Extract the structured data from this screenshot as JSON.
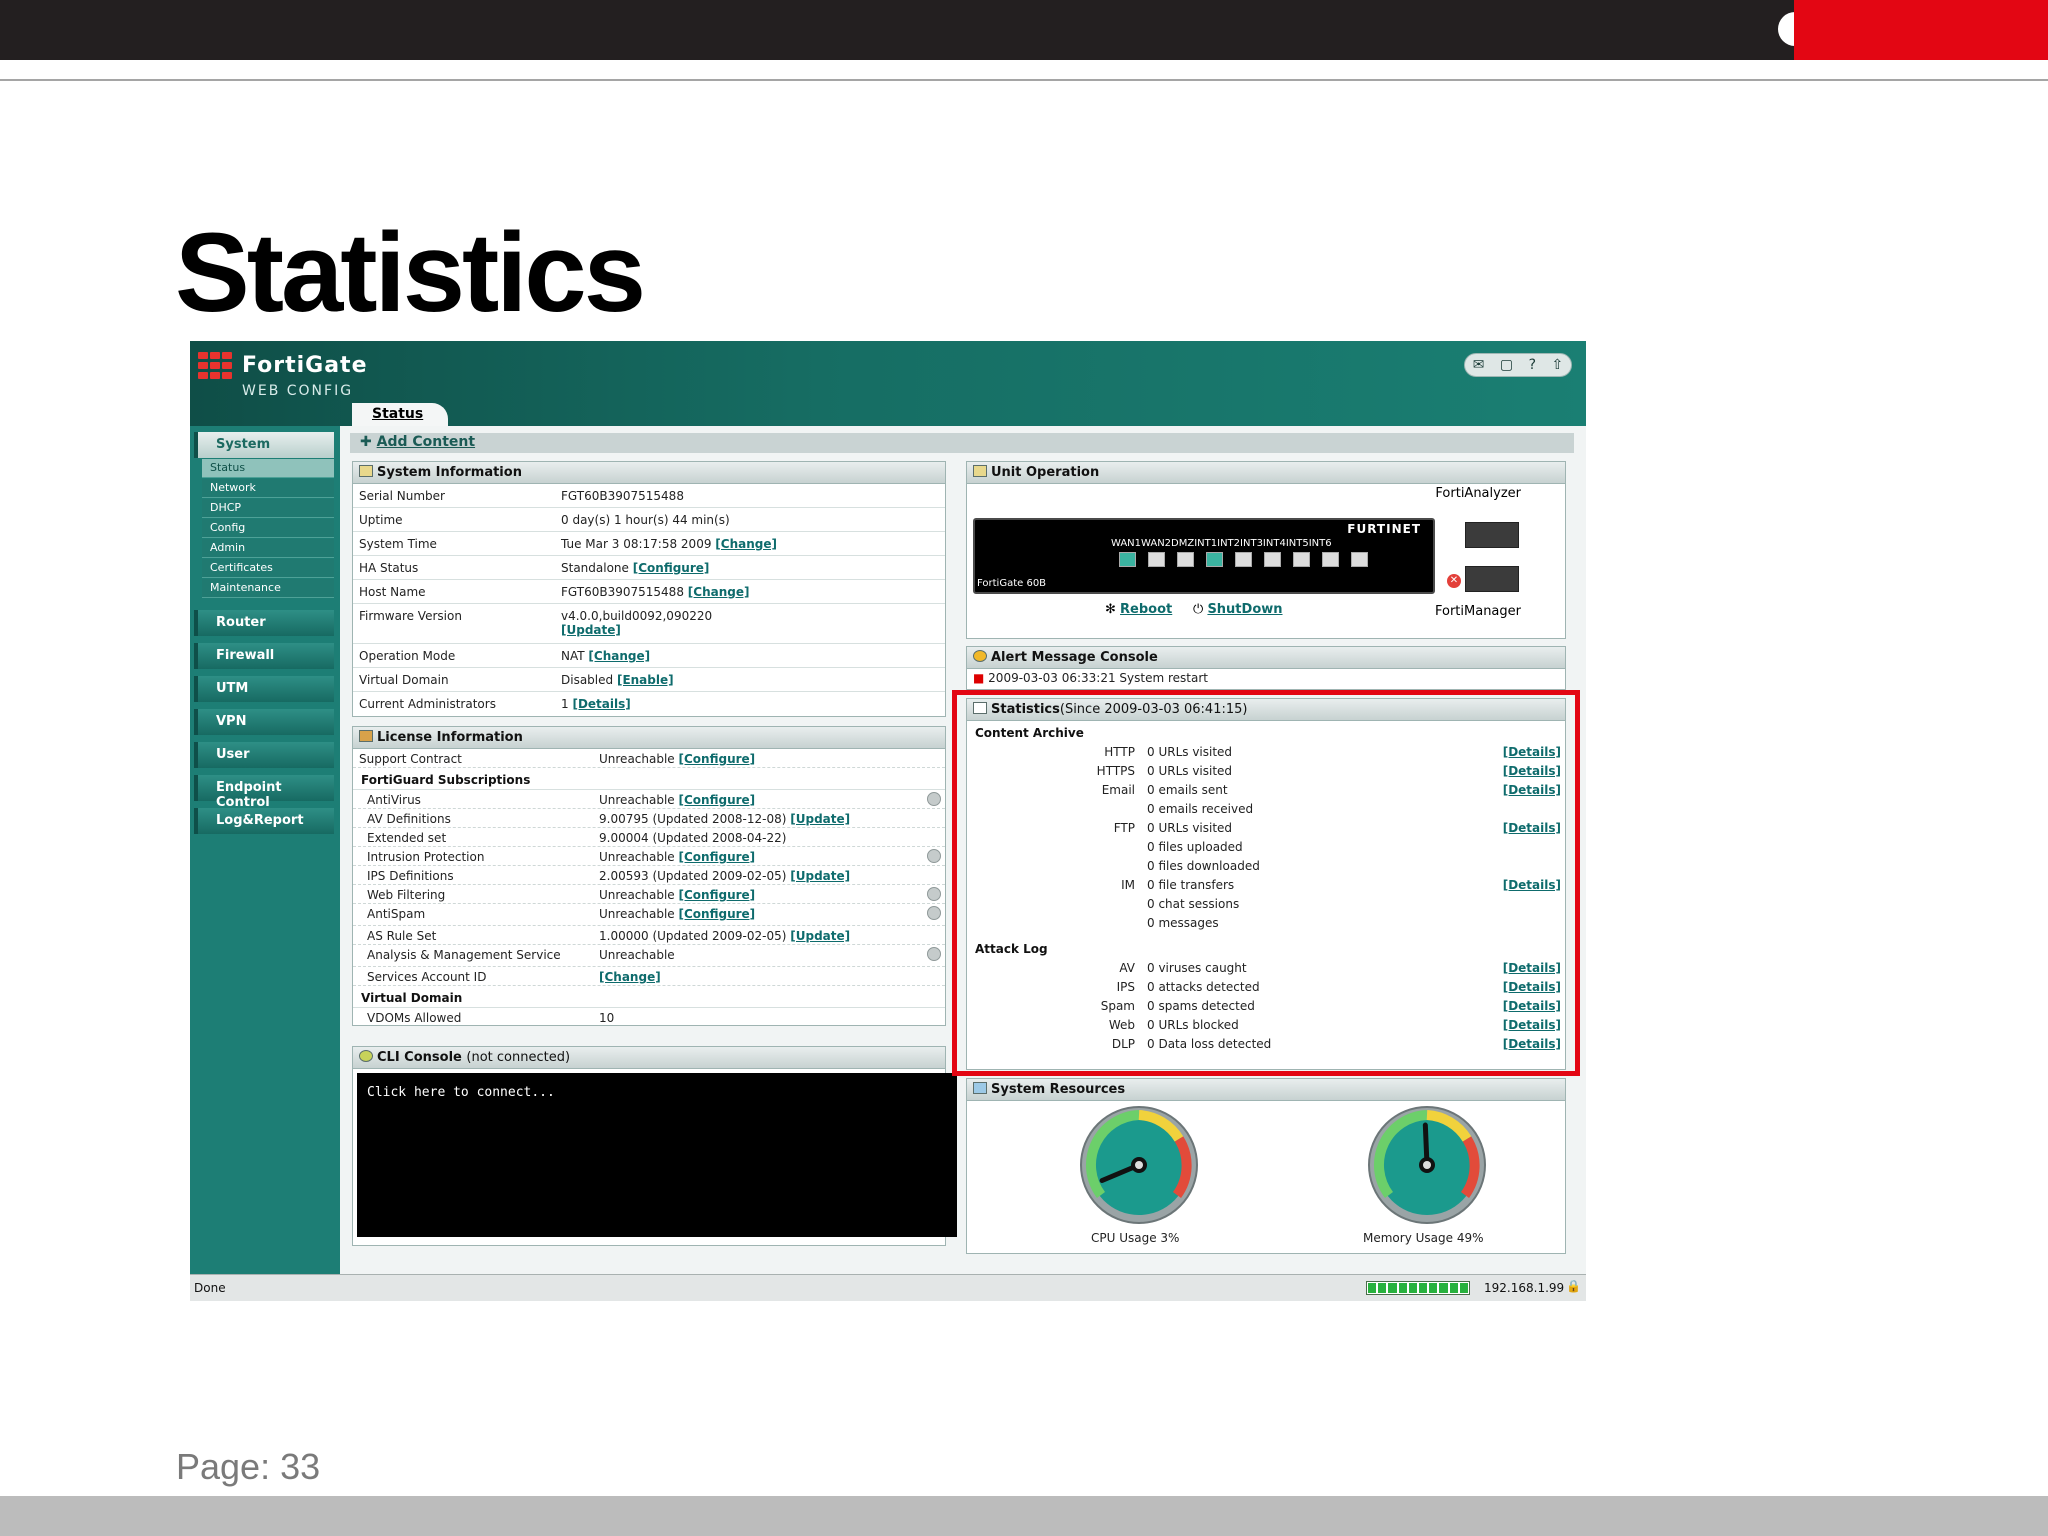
{
  "slide": {
    "title": "Statistics",
    "page": "Page: 33"
  },
  "header": {
    "brand": "FortiGate",
    "sub": "WEB CONFIG",
    "tools": [
      "speech-icon",
      "save-icon",
      "help-icon",
      "logout-icon"
    ]
  },
  "tab": {
    "label": "Status"
  },
  "sidebar": {
    "system_label": "System",
    "system_items": [
      "Status",
      "Network",
      "DHCP",
      "Config",
      "Admin",
      "Certificates",
      "Maintenance"
    ],
    "groups": [
      "Router",
      "Firewall",
      "UTM",
      "VPN",
      "User",
      "Endpoint Control",
      "Log&Report"
    ]
  },
  "add_content": "Add Content",
  "sysinfo": {
    "title": "System Information",
    "rows": [
      {
        "k": "Serial Number",
        "v": "FGT60B3907515488",
        "link": ""
      },
      {
        "k": "Uptime",
        "v": "0 day(s) 1 hour(s) 44 min(s)",
        "link": ""
      },
      {
        "k": "System Time",
        "v": "Tue Mar 3 08:17:58 2009 ",
        "link": "[Change]"
      },
      {
        "k": "HA Status",
        "v": "Standalone ",
        "link": "[Configure]"
      },
      {
        "k": "Host Name",
        "v": "FGT60B3907515488 ",
        "link": "[Change]"
      },
      {
        "k": "Firmware Version",
        "v": "v4.0.0,build0092,090220",
        "link": "[Update]"
      },
      {
        "k": "Operation Mode",
        "v": "NAT ",
        "link": "[Change]"
      },
      {
        "k": "Virtual Domain",
        "v": "Disabled ",
        "link": "[Enable]"
      },
      {
        "k": "Current Administrators",
        "v": "1 ",
        "link": "[Details]"
      }
    ]
  },
  "license": {
    "title": "License Information",
    "support_k": "Support Contract",
    "support_v": "Unreachable ",
    "support_link": "[Configure]",
    "fortiguard": "FortiGuard Subscriptions",
    "rows": [
      {
        "k": "AntiVirus",
        "v": "Unreachable ",
        "link": "[Configure]"
      },
      {
        "k": "AV Definitions",
        "v": "9.00795 (Updated 2008-12-08) ",
        "link": "[Update]"
      },
      {
        "k": "Extended set",
        "v": "9.00004 (Updated 2008-04-22)",
        "link": ""
      },
      {
        "k": "Intrusion Protection",
        "v": "Unreachable ",
        "link": "[Configure]"
      },
      {
        "k": "IPS Definitions",
        "v": "2.00593 (Updated 2009-02-05) ",
        "link": "[Update]"
      },
      {
        "k": "Web Filtering",
        "v": "Unreachable ",
        "link": "[Configure]"
      },
      {
        "k": "AntiSpam",
        "v": "Unreachable ",
        "link": "[Configure]"
      },
      {
        "k": "AS Rule Set",
        "v": "1.00000 (Updated 2009-02-05) ",
        "link": "[Update]"
      },
      {
        "k": "Analysis & Management Service",
        "v": "Unreachable",
        "link": ""
      },
      {
        "k": "Services Account ID",
        "v": "",
        "link": "[Change]"
      }
    ],
    "vdom_section": "Virtual Domain",
    "vdom_k": "VDOMs Allowed",
    "vdom_v": "10"
  },
  "cli": {
    "title": "CLI Console",
    "status": "(not connected)",
    "prompt": "Click here to connect..."
  },
  "unit": {
    "title": "Unit Operation",
    "analyzer": "FortiAnalyzer",
    "manager": "FortiManager",
    "brand": "FURTINET",
    "ports": "WAN1WAN2DMZINT1INT2INT3INT4INT5INT6",
    "model": "FortiGate 60B",
    "reboot": "Reboot",
    "shutdown": "ShutDown"
  },
  "alert": {
    "title": "Alert Message Console",
    "message": "2009-03-03 06:33:21 System restart"
  },
  "stats": {
    "title": "Statistics",
    "since": "(Since 2009-03-03 06:41:15)",
    "content_archive": "Content Archive",
    "content_rows": [
      {
        "k": "HTTP",
        "v": "0 URLs visited",
        "d": "[Details]"
      },
      {
        "k": "HTTPS",
        "v": "0 URLs visited",
        "d": "[Details]"
      },
      {
        "k": "Email",
        "v": "0 emails sent",
        "d": "[Details]"
      },
      {
        "k": "",
        "v": "0 emails received",
        "d": ""
      },
      {
        "k": "FTP",
        "v": "0 URLs visited",
        "d": "[Details]"
      },
      {
        "k": "",
        "v": "0 files uploaded",
        "d": ""
      },
      {
        "k": "",
        "v": "0 files downloaded",
        "d": ""
      },
      {
        "k": "IM",
        "v": "0 file transfers",
        "d": "[Details]"
      },
      {
        "k": "",
        "v": "0 chat sessions",
        "d": ""
      },
      {
        "k": "",
        "v": "0 messages",
        "d": ""
      }
    ],
    "attack_log": "Attack Log",
    "attack_rows": [
      {
        "k": "AV",
        "v": "0 viruses caught",
        "d": "[Details]"
      },
      {
        "k": "IPS",
        "v": "0 attacks detected",
        "d": "[Details]"
      },
      {
        "k": "Spam",
        "v": "0 spams detected",
        "d": "[Details]"
      },
      {
        "k": "Web",
        "v": "0 URLs blocked",
        "d": "[Details]"
      },
      {
        "k": "DLP",
        "v": "0 Data loss detected",
        "d": "[Details]"
      }
    ]
  },
  "resources": {
    "title": "System Resources",
    "cpu_label": "CPU Usage 3%",
    "cpu_value": 3,
    "mem_label": "Memory Usage 49%",
    "mem_value": 49
  },
  "statusbar": {
    "left": "Done",
    "ip": "192.168.1.99",
    "progress_fraction": 1.0
  },
  "colors": {
    "accent": "#1d7e75",
    "highlight": "#e30613",
    "link": "#0e6b6c"
  }
}
